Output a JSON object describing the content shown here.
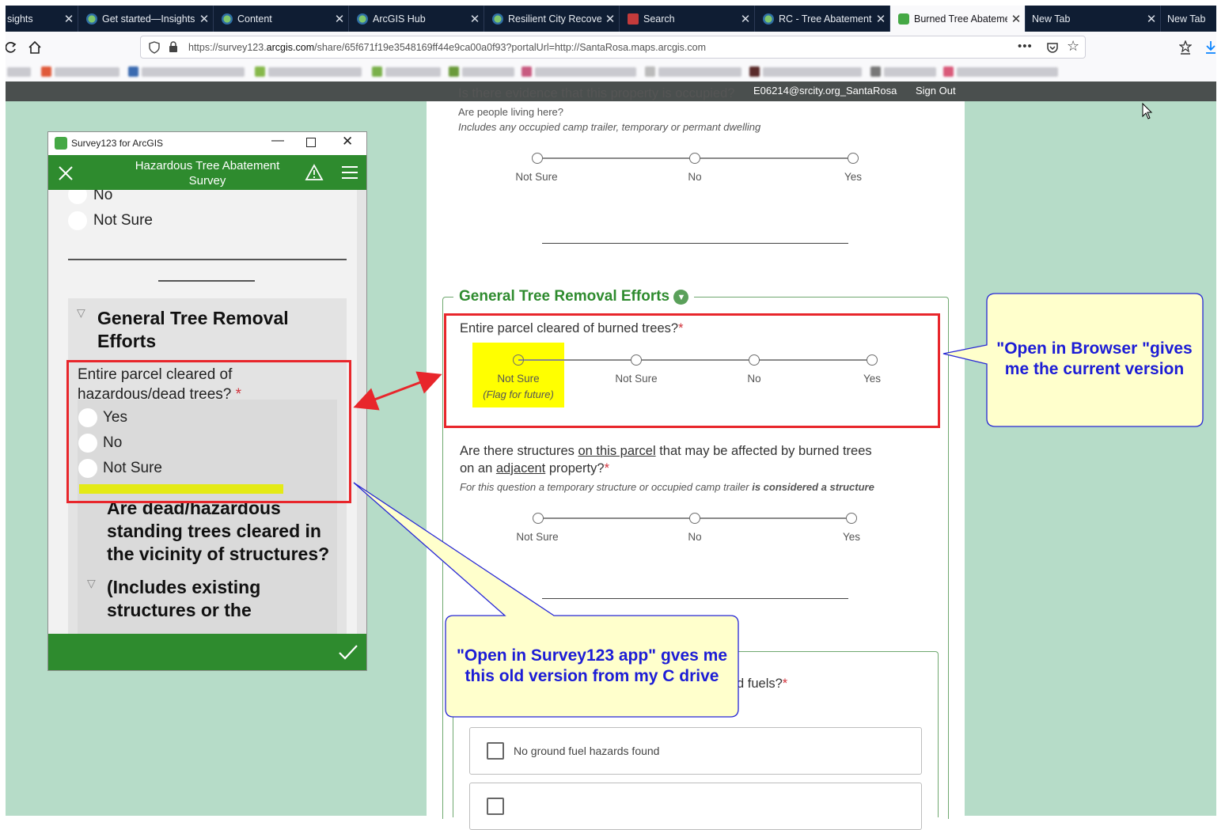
{
  "browser": {
    "tabs": [
      {
        "label": "sights",
        "active": false
      },
      {
        "label": "Get started—Insights",
        "active": false
      },
      {
        "label": "Content",
        "active": false
      },
      {
        "label": "ArcGIS Hub",
        "active": false
      },
      {
        "label": "Resilient City Recove",
        "active": false
      },
      {
        "label": "Search",
        "active": false
      },
      {
        "label": "RC - Tree Abatement",
        "active": false
      },
      {
        "label": "Burned Tree Abateme",
        "active": true
      },
      {
        "label": "New Tab",
        "active": false
      },
      {
        "label": "New Tab",
        "active": false
      }
    ],
    "url_prefix": "https://survey123.",
    "url_domain": "arcgis.com",
    "url_rest": "/share/65f671f19e3548169ff44e9ca00a0f93?portalUrl=http://SantaRosa.maps.arcgis.com"
  },
  "page": {
    "user": "E06214@srcity.org_SantaRosa",
    "sign_out": "Sign Out",
    "q1": {
      "title": "Is there evidence that this property is occupied?",
      "subtitle": "Are people living here?",
      "hint": "Includes any occupied camp trailer, temporary or permant dwelling",
      "options": [
        "Not Sure",
        "No",
        "Yes"
      ]
    },
    "group1": {
      "title": "General Tree Removal Efforts",
      "q2": {
        "title": "Entire parcel cleared of burned trees?",
        "required": "*",
        "options": [
          "Not Sure",
          "Not Sure",
          "No",
          "Yes"
        ],
        "option1_sub": "(Flag for future)"
      },
      "q3": {
        "title_a": "Are there structures ",
        "title_b": "on this parcel",
        "title_c": " that may be affected by burned trees",
        "title_d": "on an ",
        "title_e": "adjacent",
        "title_f": " property?",
        "required": "*",
        "hint_a": "For this question a temporary structure or occupied camp trailer ",
        "hint_b": "is considered a structure",
        "options": [
          "Not Sure",
          "No",
          "Yes"
        ]
      }
    },
    "group2": {
      "partial_title": "d fuels?",
      "required": "*",
      "checkbox1": "No ground fuel hazards found"
    }
  },
  "app": {
    "window_title": "Survey123 for ArcGIS",
    "header_title": "Hazardous Tree Abatement Survey",
    "prev_options": [
      "No",
      "Not Sure"
    ],
    "group_title": "General Tree Removal Efforts",
    "question": "Entire parcel cleared of hazardous/dead trees?",
    "required": "*",
    "options": [
      "Yes",
      "No",
      "Not Sure"
    ],
    "next_question": "Are dead/hazardous standing trees cleared in the vicinity of structures?",
    "next_group": "(Includes existing structures or the"
  },
  "annotations": {
    "callout_browser": "\"Open in Browser \"gives me the current version",
    "callout_app": "\"Open in Survey123 app\" gves me this old version from my C drive"
  },
  "colors": {
    "page_bg": "#b6dcc8",
    "accent_green": "#2e8b2e",
    "highlight_yellow": "#ffff00",
    "annotation_red": "#e8262b",
    "callout_fill": "#ffffcc",
    "callout_text": "#1c1cd6"
  }
}
